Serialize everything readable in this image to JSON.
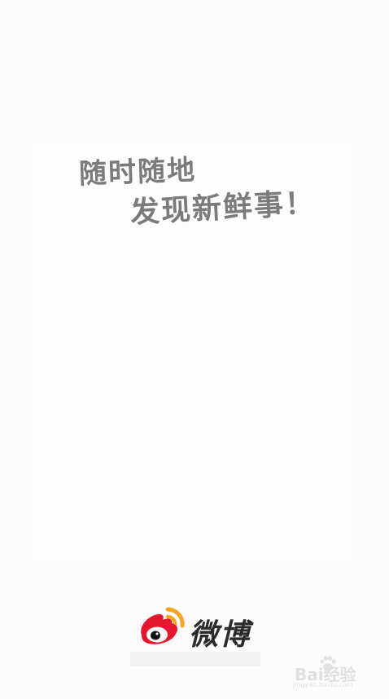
{
  "splash": {
    "slogan_line_1": "随时随地",
    "slogan_line_2": "发现新鲜事！"
  },
  "logo": {
    "icon": "weibo-logo-icon",
    "text": "微博"
  },
  "watermark": {
    "text": "Bai经验",
    "url": "jingyan.baidu.com",
    "icon": "paw-icon"
  },
  "colors": {
    "background": "#fcfcfc",
    "slogan": "#7b7b7b",
    "logo_red": "#e6162d",
    "logo_orange": "#f5a623",
    "logo_text": "#2b2b2b"
  }
}
